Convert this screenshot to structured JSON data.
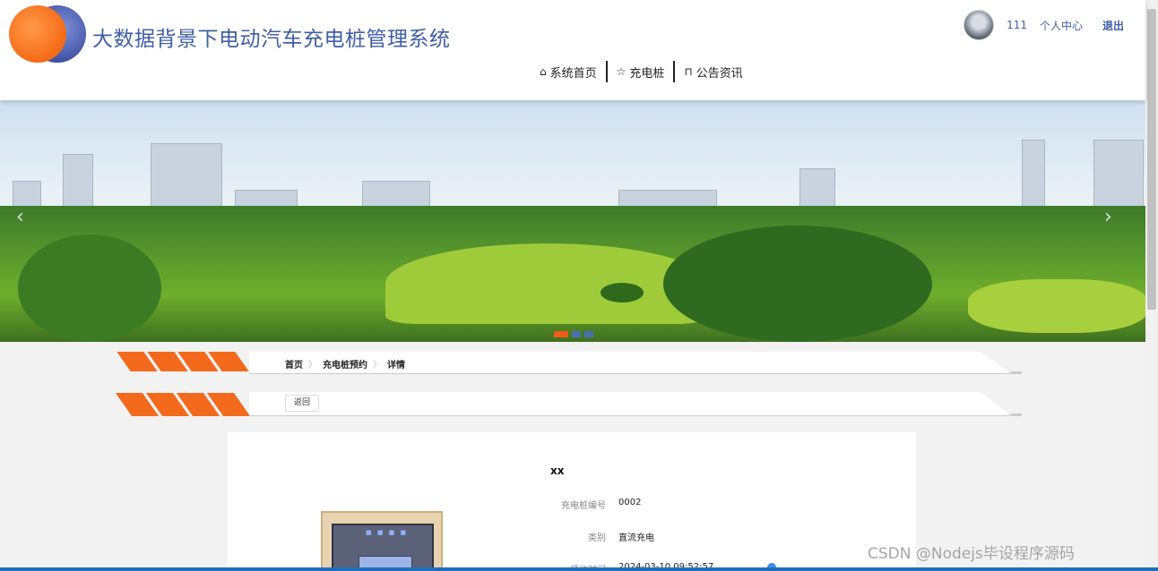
{
  "header": {
    "site_title": "大数据背景下电动汽车充电桩管理系统",
    "user_id": "111",
    "personal_center": "个人中心",
    "logout": "退出"
  },
  "nav": {
    "items": [
      {
        "label": "系统首页",
        "icon": "home-icon"
      },
      {
        "label": "充电桩",
        "icon": "star-icon"
      },
      {
        "label": "公告资讯",
        "icon": "bag-icon"
      }
    ]
  },
  "banner": {
    "prev_arrow": "‹",
    "next_arrow": "›"
  },
  "breadcrumb": {
    "items": [
      "首页",
      "充电桩预约",
      "详情"
    ],
    "separator": "〉"
  },
  "actions": {
    "back_label": "返回"
  },
  "detail": {
    "name": "xx",
    "fields": [
      {
        "label": "充电桩编号",
        "value": "0002"
      },
      {
        "label": "类别",
        "value": "直流充电"
      },
      {
        "label": "预约时间",
        "value": "2024-03-10 09:52:57"
      }
    ]
  },
  "watermark": "CSDN @Nodejs毕设程序源码",
  "colors": {
    "accent_orange": "#f36a1c",
    "title_blue": "#3e5fa6"
  }
}
